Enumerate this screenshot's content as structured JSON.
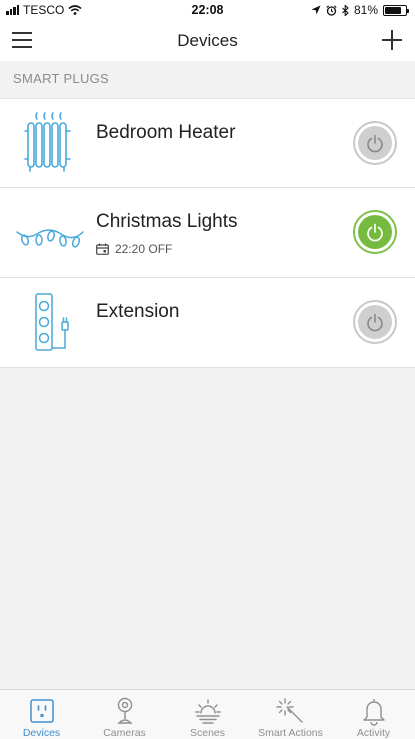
{
  "status_bar": {
    "carrier": "TESCO",
    "time": "22:08",
    "battery": "81%",
    "battery_level": 0.81,
    "icons": [
      "signal-icon",
      "wifi-icon",
      "location-icon",
      "alarm-icon",
      "bluetooth-icon",
      "battery-icon"
    ]
  },
  "navbar": {
    "title": "Devices",
    "menu_icon": "hamburger-icon",
    "add_icon": "plus-icon"
  },
  "section": {
    "title": "SMART PLUGS"
  },
  "devices": [
    {
      "name": "Bedroom Heater",
      "icon": "heater-icon",
      "schedule": "",
      "power": "off"
    },
    {
      "name": "Christmas Lights",
      "icon": "string-lights-icon",
      "schedule": "22:20 OFF",
      "power": "on"
    },
    {
      "name": "Extension",
      "icon": "extension-lead-icon",
      "schedule": "",
      "power": "off"
    }
  ],
  "tabs": [
    {
      "label": "Devices",
      "icon": "plug-socket-icon",
      "active": true
    },
    {
      "label": "Cameras",
      "icon": "camera-icon",
      "active": false
    },
    {
      "label": "Scenes",
      "icon": "sunset-icon",
      "active": false
    },
    {
      "label": "Smart Actions",
      "icon": "magic-wand-icon",
      "active": false
    },
    {
      "label": "Activity",
      "icon": "bell-icon",
      "active": false
    }
  ],
  "colors": {
    "accent_blue": "#3f8fd2",
    "icon_blue": "#4aa9dc",
    "power_on_green": "#76bb3f",
    "power_off_grey": "#cfcfcf"
  }
}
